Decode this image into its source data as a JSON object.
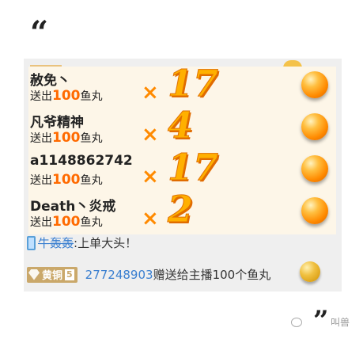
{
  "quote_open": "“",
  "quote_close": "”",
  "gifts": [
    {
      "user": "赦免丶",
      "action_prefix": "送出",
      "amount": "100",
      "item": "鱼丸",
      "combo_sign": "×",
      "combo": "17"
    },
    {
      "user": "凡爷精神",
      "action_prefix": "送出",
      "amount": "100",
      "item": "鱼丸",
      "combo_sign": "×",
      "combo": "4"
    },
    {
      "user": "a1148862742",
      "action_prefix": "送出",
      "amount": "100",
      "item": "鱼丸",
      "combo_sign": "×",
      "combo": "17"
    },
    {
      "user": "Death丶炎戒",
      "action_prefix": "送出",
      "amount": "100",
      "item": "鱼丸",
      "combo_sign": "×",
      "combo": "2"
    }
  ],
  "chat": [
    {
      "user": "牛轰轰",
      "separator": ":",
      "message": "上单大头！"
    },
    {
      "badge": "黄铜",
      "badge_level": "5",
      "user": "277248903",
      "message": "赠送给主播100个鱼丸"
    }
  ],
  "watermark": "叫兽",
  "colors": {
    "amount": "#ff6a00",
    "username": "#3a7fd0",
    "combo": "#ffb000",
    "banner_bg": "#fdf6e8"
  }
}
